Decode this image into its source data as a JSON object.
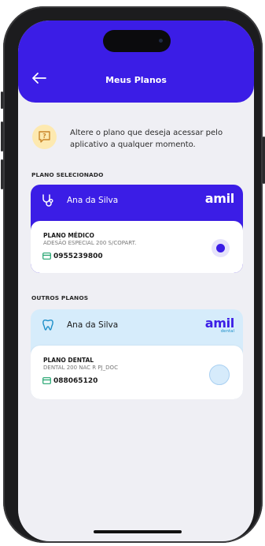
{
  "header": {
    "title": "Meus Planos",
    "back_icon": "arrow-left-icon"
  },
  "info": {
    "text": "Altere o plano que deseja acessar pelo aplicativo a qualquer momento.",
    "icon": "question-bubble-icon"
  },
  "sections": {
    "selected_label": "PLANO SELECIONADO",
    "others_label": "OUTROS PLANOS"
  },
  "selected_plan": {
    "holder": "Ana da Silva",
    "brand": "amil",
    "type": "PLANO MÉDICO",
    "name": "ADESÃO ESPECIAL 200 S/COPART.",
    "number": "0955239800",
    "selected": true,
    "accent": "#3b1de6"
  },
  "other_plan": {
    "holder": "Ana da Silva",
    "brand": "amil",
    "brand_sub": "dental",
    "type": "PLANO DENTAL",
    "name": "DENTAL 200 NAC R PJ_DOC",
    "number": "088065120",
    "selected": false,
    "accent": "#d6ecfb"
  }
}
